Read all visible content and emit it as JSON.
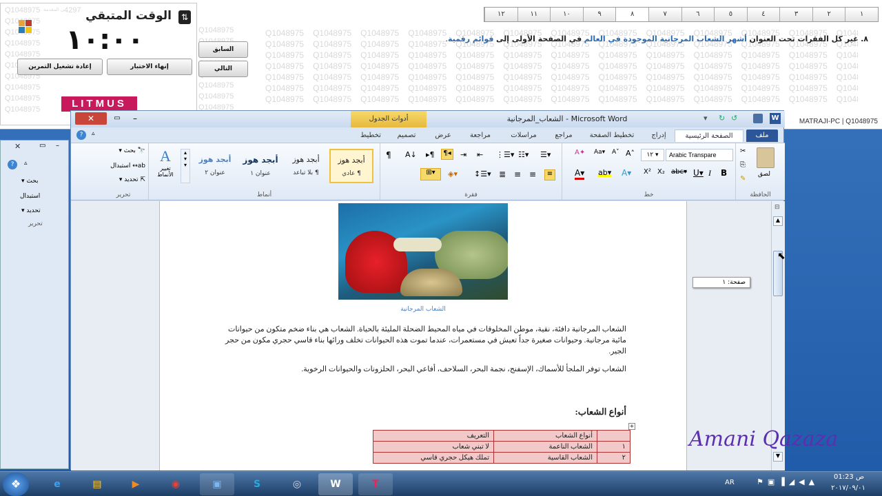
{
  "exam": {
    "timer_title": "الوقت المتبقي",
    "timer_value": "١٠:٠٠",
    "watermark": "Q1048975",
    "watermark_corner": "4297",
    "watermark_hint": "احتار الى المقدمة",
    "btn_end": "إنهاء الاختبار",
    "btn_restart": "إعادة تشغيل التمرين",
    "btn_prev": "السابق",
    "btn_next": "التالي",
    "logo": "LITMUS",
    "pages": [
      "١",
      "٢",
      "٣",
      "٤",
      "٥",
      "٦",
      "٧",
      "٨",
      "٩",
      "١٠",
      "١١",
      "١٢"
    ],
    "active_page": "٨",
    "question_number": "٨.",
    "question_plain1": "غير كل الفقرات تحت العنوان",
    "question_link": "أشهر الشعاب المرجانية الموجودة في العالم",
    "question_plain2": "في الصفحة الأولى إلى",
    "question_bold": "قوائم رقمية",
    "question_end": "."
  },
  "word": {
    "title": "الشعاب_المرجانية - Microsoft Word",
    "context_tab": "أدوات الجدول",
    "tabs": [
      "ملف",
      "الصفحة الرئيسية",
      "إدراج",
      "تخطيط الصفحة",
      "مراجع",
      "مراسلات",
      "مراجعة",
      "عرض",
      "تصميم",
      "تخطيط"
    ],
    "machine": "MATRAJI-PC | Q1048975",
    "clipboard_label": "الحافظة",
    "paste_label": "لصق",
    "font_label": "خط",
    "font_name": "Arabic Transpare",
    "font_size": "١٢",
    "paragraph_label": "فقرة",
    "styles_label": "أنماط",
    "styles": [
      {
        "preview": "أبجد هوز",
        "name": "¶ عادي"
      },
      {
        "preview": "أبجد هوز",
        "name": "¶ بلا تباعد"
      },
      {
        "preview": "أبجد هوز",
        "name": "عنوان ١"
      },
      {
        "preview": "أبجد هوز",
        "name": "عنوان ٢"
      }
    ],
    "change_styles": "تغيير الأنماط",
    "editing_label": "تحرير",
    "find": "بحث",
    "replace": "استبدال",
    "select": "تحديد",
    "page_tooltip": "صفحة: ١",
    "caption": "الشعاب المرجانية",
    "para1": "الشعاب المرجانية دافئة، نقية، موطن المخلوقات في مياه المحيط الضحلة المليئة بالحياة. الشعاب هي بناء ضخم متكون من حيوانات مائية مرجانية. وحيوانات صغيرة جداً تعيش في مستعمرات، عندما تموت هذه الحيوانات تخلف ورائها بناء قاسي حجري مكون من حجر الجير.",
    "para2": "الشعاب توفر الملجأ للأسماك، الإسفنج، نجمة البحر، السلاحف، أفاعي البحر، الحلزونات والحيوانات الرخوية.",
    "heading": "أنواع الشعاب:",
    "table": {
      "headers": [
        "",
        "أنواع الشعاب",
        "التعريف"
      ],
      "rows": [
        [
          "١",
          "الشعاب الناعمة",
          "لا تبني شعاب"
        ],
        [
          "٢",
          "الشعاب القاسية",
          "تملك هيكل حجري قاسي"
        ]
      ]
    }
  },
  "signature": "Amani Qazaza",
  "taskbar": {
    "lang": "AR",
    "time": "01:23 ص",
    "date": "٢٠١٧/٠٩/٠١"
  },
  "colors": {
    "accent": "#2b579a",
    "highlight": "#f0c13c",
    "table_fill": "#f2c8c8",
    "logo": "#c8195d"
  }
}
